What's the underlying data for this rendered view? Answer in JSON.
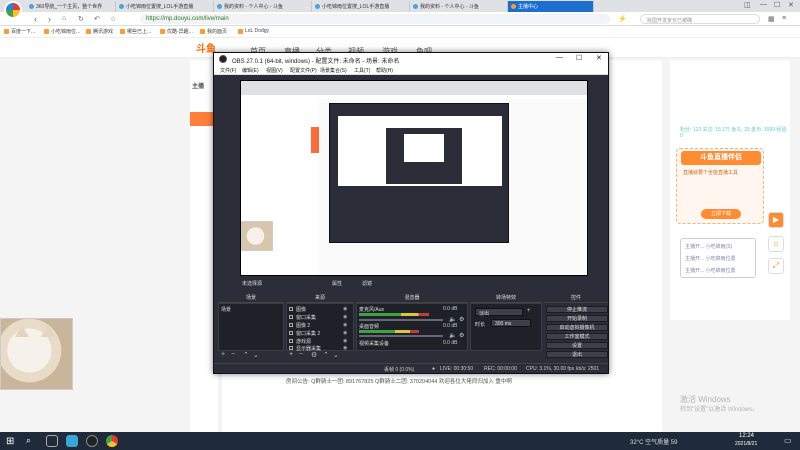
{
  "browser": {
    "tabs": [
      {
        "label": "360导航_一个主页，整个世界"
      },
      {
        "label": "小吃锦雨位置搜_LOL手游直播"
      },
      {
        "label": "我的资料 - 个人中心 - 斗鱼"
      },
      {
        "label": "小吃锦雨位置搜_LOL手游直播"
      },
      {
        "label": "我的资料 - 个人中心 - 斗鱼"
      },
      {
        "label": "主播中心"
      }
    ],
    "url": "https://mp.douyu.com/live/main",
    "search_placeholder": "跨国开发家长已被确",
    "bookmarks": [
      "百度一下...",
      "小吃锦雨位...",
      "腾讯游戏",
      "哪些已上...",
      "优酷-异趣...",
      "我的面页",
      "LoL Dodgy"
    ]
  },
  "site": {
    "logo": "斗鱼",
    "nav": [
      "首页",
      "直播",
      "分类",
      "视频",
      "游戏",
      "鱼吧"
    ],
    "sidebar": [
      "主播",
      "",
      "",
      "",
      "",
      ""
    ],
    "stats": "粉丝: 122   关注: 15.1万   鱼丸: 25   金币: 3999   经验: 0",
    "promo_title": "斗鱼直播伴侣",
    "promo_sub": "直播就要个全能直播工具",
    "promo_cta": "立即下载",
    "chat_lines": [
      "主播开... 小吃锦雨(S)",
      "主播开... 小吃锦雨位置",
      "主播开... 小吃锦雨位置"
    ],
    "announcement": "房间公告:",
    "announcement_body": "Q群骑士一团: 891767825 Q群骑士二团: 370204044 欢迎各位大佬同归加入 重中啊",
    "watermark_title": "激活 Windows",
    "watermark_sub": "转到\"设置\"以激活 Windows。"
  },
  "obs": {
    "title": "OBS 27.0.1 (64-bit, windows) - 配置文件: 未命名 - 场景: 未命名",
    "menu": [
      "文件(F)",
      "编辑(E)",
      "视图(V)",
      "配置文件(P)",
      "场景集合(S)",
      "工具(T)",
      "帮助(H)"
    ],
    "status_row_left": "未选择源",
    "status_row_props": "属性",
    "status_row_filters": "滤镜",
    "docks": {
      "scenes": "场景",
      "sources": "来源",
      "mixer": "混音器",
      "transitions": "转场特效",
      "controls": "控件"
    },
    "scenes": [
      "场景"
    ],
    "sources": [
      "图像",
      "窗口采集",
      "图像 2",
      "窗口采集 2",
      "游戏源",
      "显示器采集"
    ],
    "mixer": [
      {
        "name": "麦克风/Aux",
        "db": "0.0 dB"
      },
      {
        "name": "桌面音频",
        "db": "0.0 dB"
      },
      {
        "name": "视频采集设备",
        "db": "0.0 dB"
      }
    ],
    "transition_type": "淡出",
    "transition_duration_label": "时长",
    "transition_duration": "300 ms",
    "controls": [
      "停止推流",
      "开始录制",
      "启动虚拟摄像机",
      "工作室模式",
      "设置",
      "退出"
    ],
    "statusbar": {
      "dropped": "丢帧 0 (0.0%)",
      "live": "LIVE: 00:30:50",
      "rec": "REC: 00:00:00",
      "cpu": "CPU: 3.1%, 30.00 fps",
      "kbps": "kb/s: 2501"
    }
  },
  "taskbar": {
    "weather": "32°C 空气质量 59",
    "time": "12:24",
    "date": "2021/8/21"
  }
}
